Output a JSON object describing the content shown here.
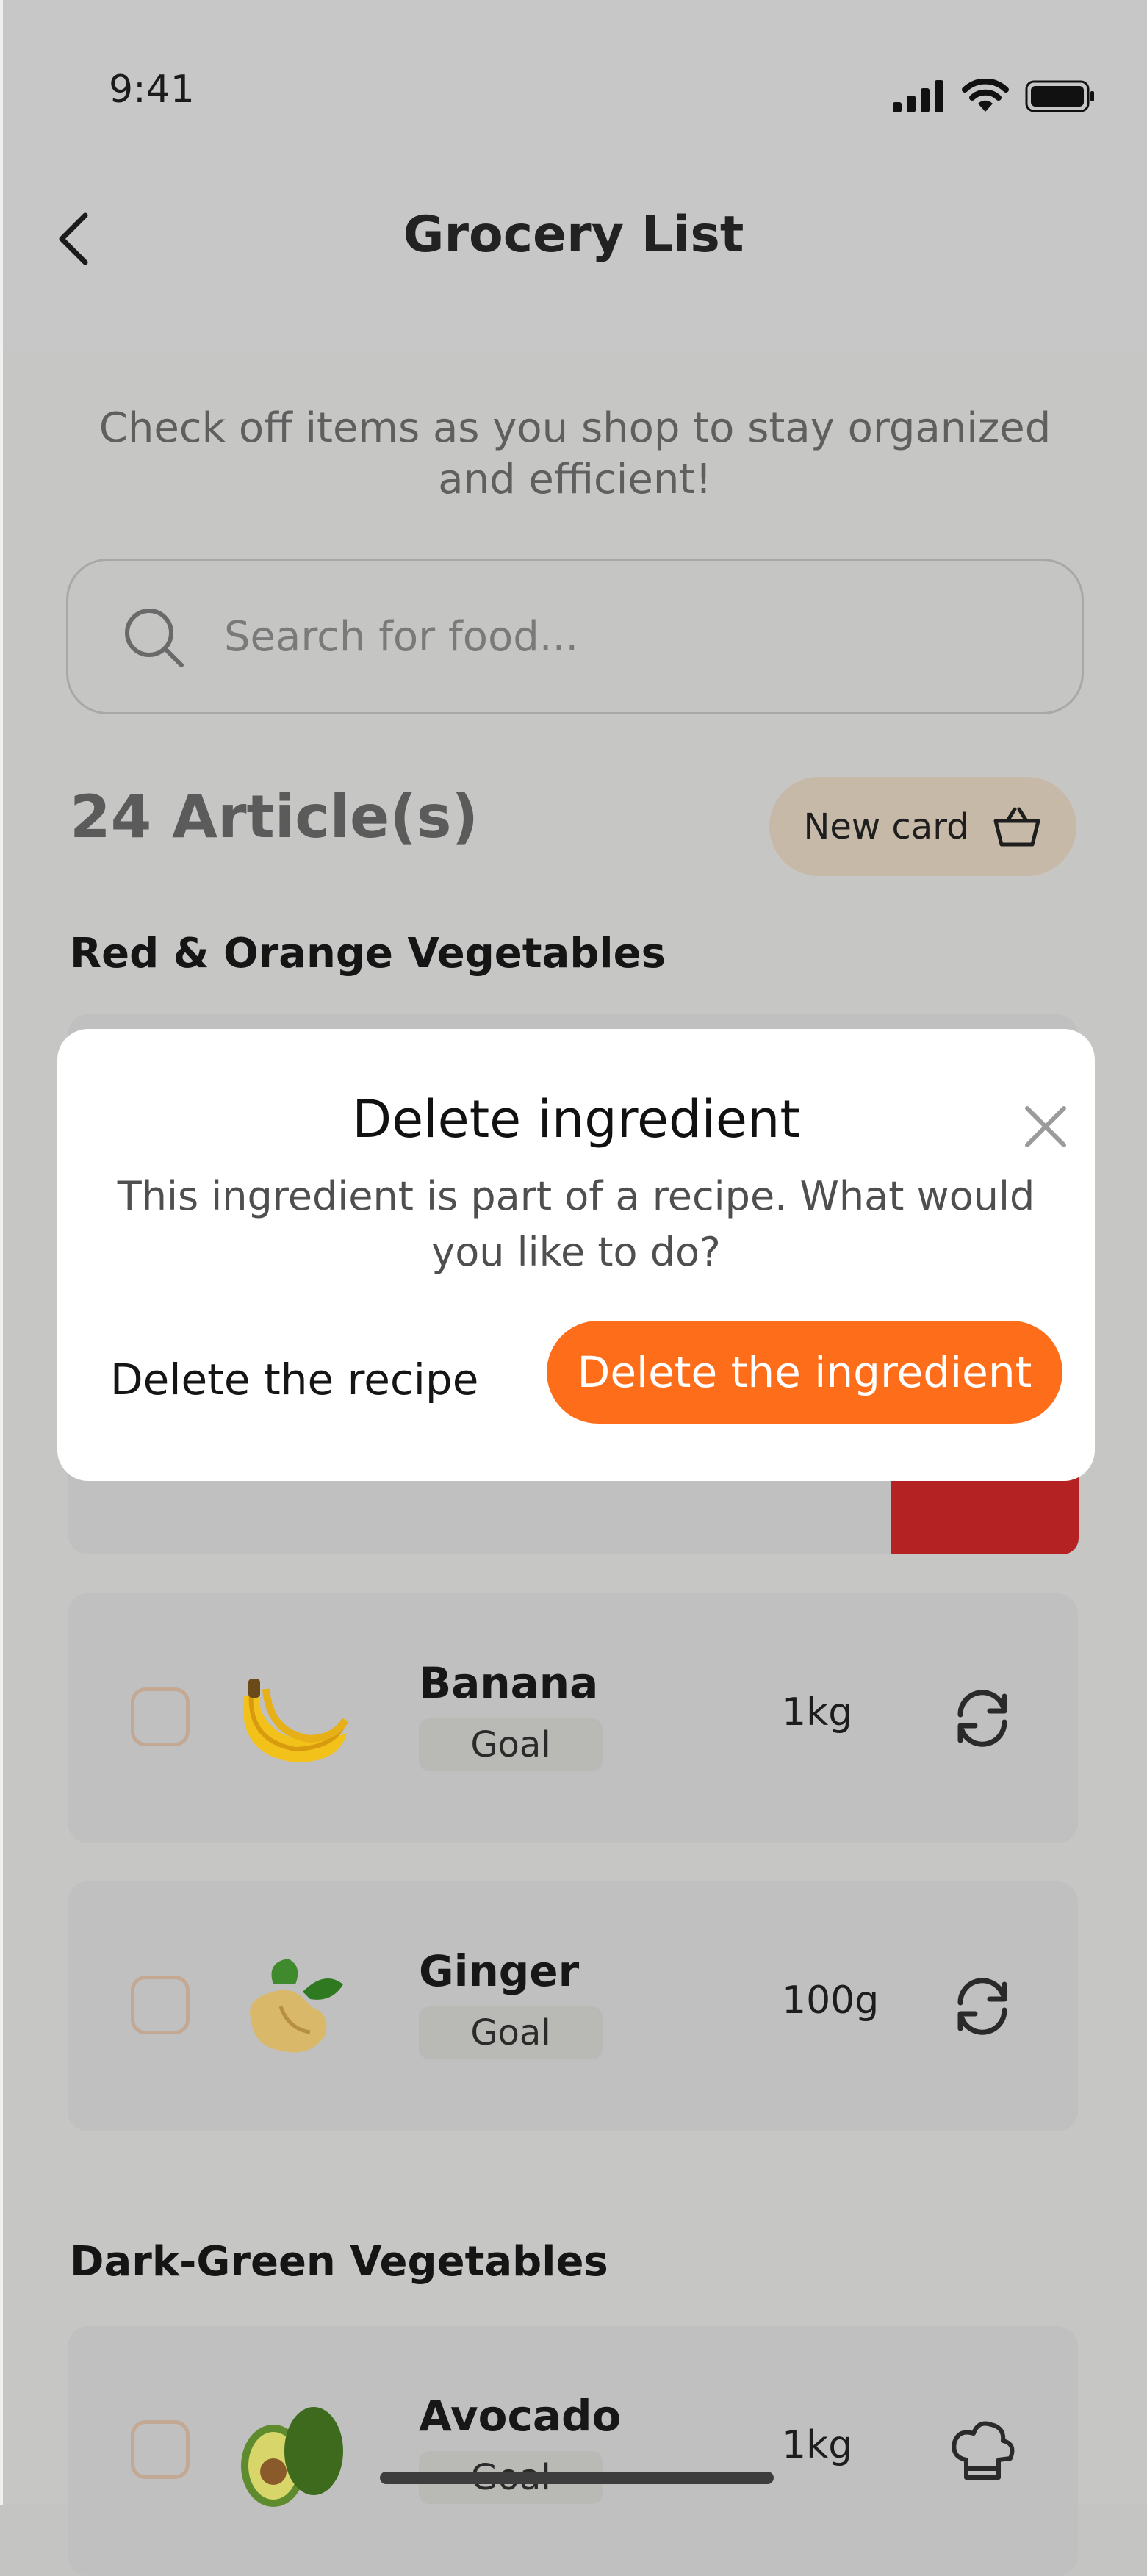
{
  "status_bar": {
    "time": "9:41"
  },
  "header": {
    "title": "Grocery List"
  },
  "subtitle": "Check off items as you shop to stay organized and efficient!",
  "search": {
    "placeholder": "Search for food..."
  },
  "summary": {
    "count_label": "24 Article(s)",
    "new_card_label": "New card"
  },
  "sections": [
    {
      "title": "Red & Orange Vegetables"
    },
    {
      "title": "Dark-Green Vegetables"
    }
  ],
  "items": [
    {
      "name": "Banana",
      "tag": "Goal",
      "qty": "1kg",
      "action_icon": "refresh-icon"
    },
    {
      "name": "Ginger",
      "tag": "Goal",
      "qty": "100g",
      "action_icon": "refresh-icon"
    },
    {
      "name": "Avocado",
      "tag": "Goal",
      "qty": "1kg",
      "action_icon": "chef-hat-icon"
    }
  ],
  "modal": {
    "title": "Delete ingredient",
    "body": "This ingredient is part of a recipe. What would you like to do?",
    "secondary_label": "Delete the recipe",
    "primary_label": "Delete the ingredient"
  },
  "colors": {
    "accent": "#FE6E1A",
    "danger": "#B52223",
    "overlay": "#C6C6C4"
  }
}
